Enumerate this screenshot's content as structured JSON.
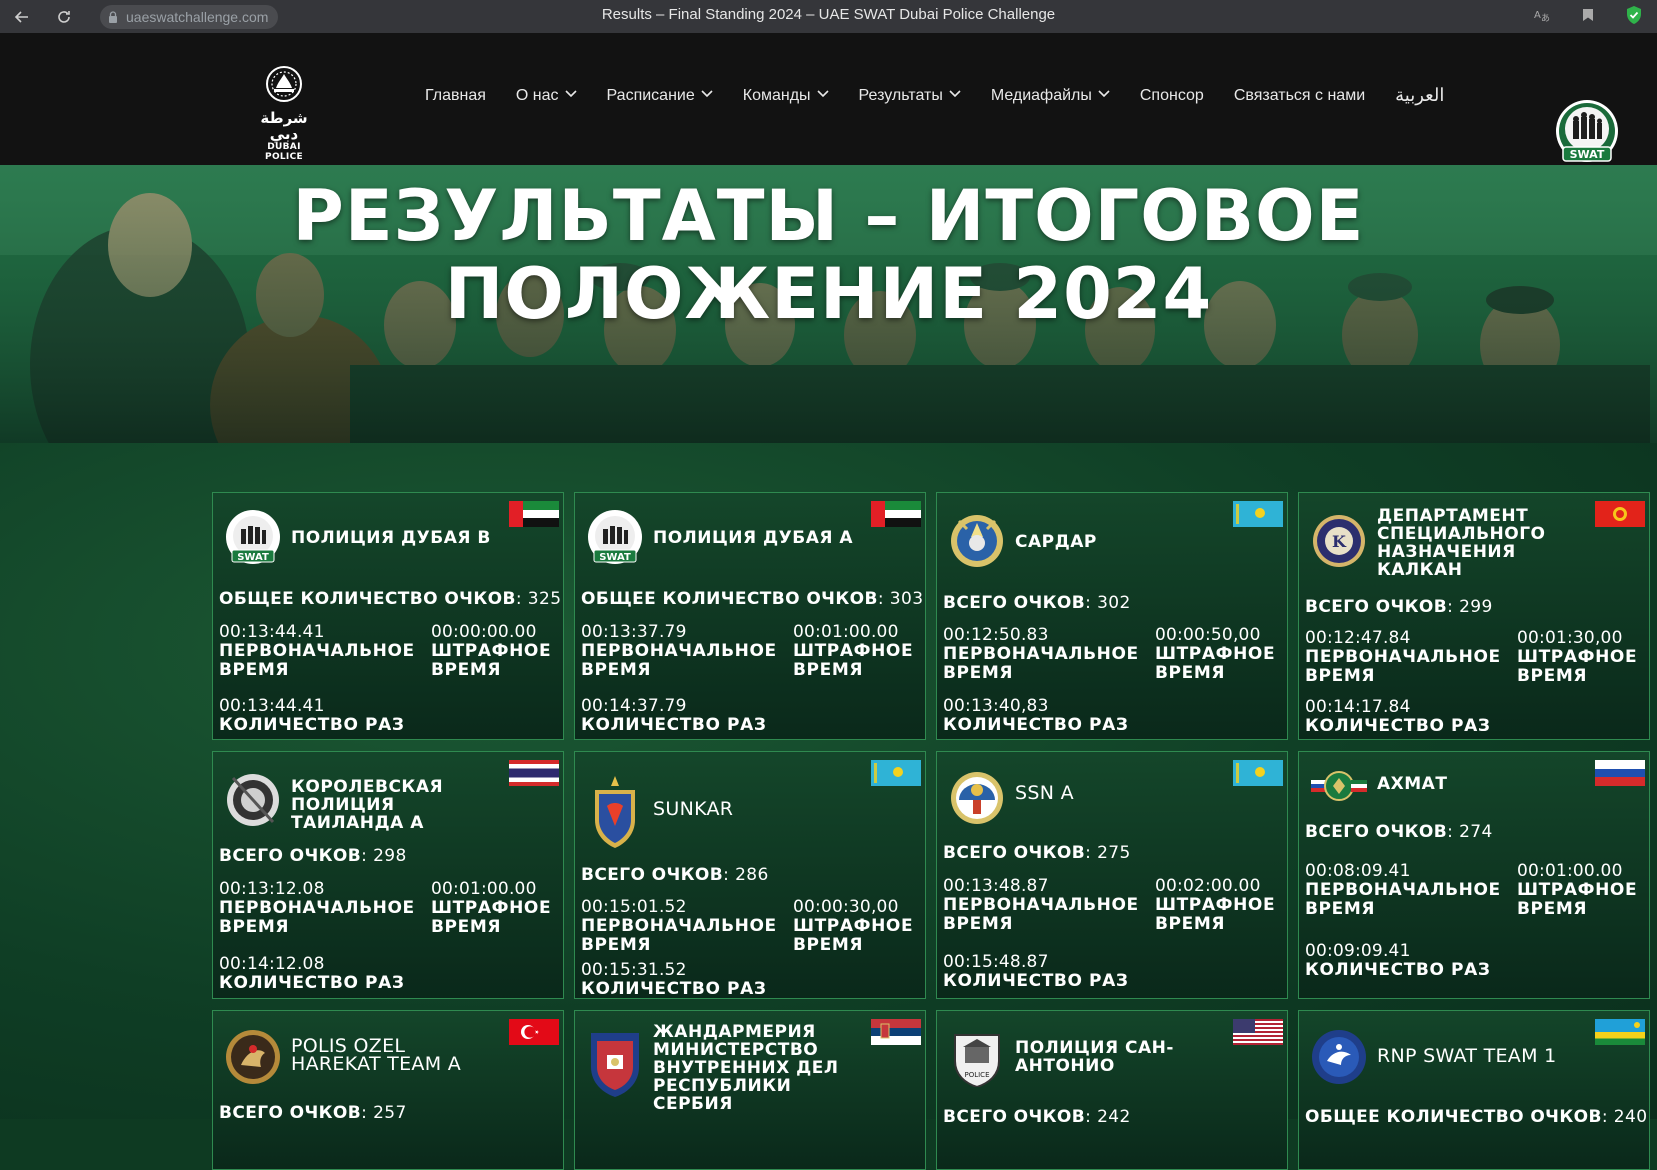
{
  "browser": {
    "url": "uaeswatchallenge.com",
    "title": "Results – Final Standing 2024 – UAE SWAT Dubai Police Challenge"
  },
  "header": {
    "logo_ar": "شرطة دبي",
    "logo_en": "DUBAI POLICE",
    "nav": [
      {
        "label": "Главная",
        "dropdown": false
      },
      {
        "label": "О нас",
        "dropdown": true
      },
      {
        "label": "Расписание",
        "dropdown": true
      },
      {
        "label": "Команды",
        "dropdown": true
      },
      {
        "label": "Результаты",
        "dropdown": true
      },
      {
        "label": "Медиафайлы",
        "dropdown": true
      },
      {
        "label": "Спонсор",
        "dropdown": false
      },
      {
        "label": "Связаться с нами",
        "dropdown": false
      },
      {
        "label": "العربية",
        "dropdown": false
      }
    ],
    "swat_label": "SWAT"
  },
  "hero": {
    "title_line1": "РЕЗУЛЬТАТЫ – ИТОГОВОЕ",
    "title_line2": "ПОЛОЖЕНИЕ 2024"
  },
  "labels": {
    "initial_time": "ПЕРВОНАЧАЛЬНОЕ ВРЕМЯ",
    "penalty_time": "ШТРАФНОЕ ВРЕМЯ",
    "count": "КОЛИЧЕСТВО РАЗ"
  },
  "teams": [
    {
      "name": "ПОЛИЦИЯ ДУБАЯ B",
      "flag": "uae",
      "logo": "swat-icon",
      "points_label": "ОБЩЕЕ КОЛИЧЕСТВО ОЧКОВ",
      "points": ": 325",
      "initial": "00:13:44.41",
      "penalty": "00:00:00.00",
      "total": "00:13:44.41"
    },
    {
      "name": "ПОЛИЦИЯ ДУБАЯ A",
      "flag": "uae",
      "logo": "swat-icon",
      "points_label": "ОБЩЕЕ КОЛИЧЕСТВО ОЧКОВ",
      "points": ": 303",
      "initial": "00:13:37.79",
      "penalty": "00:01:00.00",
      "total": "00:14:37.79"
    },
    {
      "name": "САРДАР",
      "flag": "kazakhstan",
      "logo": "sardar-emblem-icon",
      "points_label": "ВСЕГО ОЧКОВ",
      "points": ": 302",
      "initial": "00:12:50.83",
      "penalty": "00:00:50,00",
      "total": "00:13:40,83"
    },
    {
      "name": "ДЕПАРТАМЕНТ СПЕЦИАЛЬНОГО НАЗНАЧЕНИЯ КАЛКАН",
      "flag": "kyrgyzstan",
      "logo": "kalkan-emblem-icon",
      "points_label": "ВСЕГО ОЧКОВ",
      "points": ": 299",
      "initial": "00:12:47.84",
      "penalty": "00:01:30,00",
      "total": "00:14:17.84"
    },
    {
      "name": "КОРОЛЕВСКАЯ ПОЛИЦИЯ ТАИЛАНДА A",
      "flag": "thailand",
      "logo": "thai-police-emblem-icon",
      "points_label": "ВСЕГО ОЧКОВ",
      "points": ": 298",
      "initial": "00:13:12.08",
      "penalty": "00:01:00.00",
      "total": "00:14:12.08"
    },
    {
      "name": "SUNKAR",
      "flag": "kazakhstan",
      "logo": "sunkar-emblem-icon",
      "points_label": "ВСЕГО ОЧКОВ",
      "points": ": 286",
      "initial": "00:15:01.52",
      "penalty": "00:00:30,00",
      "total": "00:15:31.52"
    },
    {
      "name": "SSN A",
      "flag": "kazakhstan",
      "logo": "ssn-emblem-icon",
      "points_label": "ВСЕГО ОЧКОВ",
      "points": ": 275",
      "initial": "00:13:48.87",
      "penalty": "00:02:00.00",
      "total": "00:15:48.87"
    },
    {
      "name": "АХМАТ",
      "flag": "russia",
      "logo": "akhmat-emblem-icon",
      "points_label": "ВСЕГО ОЧКОВ",
      "points": ": 274",
      "initial": "00:08:09.41",
      "penalty": "00:01:00.00",
      "total": "00:09:09.41"
    },
    {
      "name": "POLIS OZEL HAREKAT TEAM A",
      "flag": "turkey",
      "logo": "turkiye-emblem-icon",
      "points_label": "ВСЕГО ОЧКОВ",
      "points": ": 257"
    },
    {
      "name": "ЖАНДАРМЕРИЯ МИНИСТЕРСТВО ВНУТРЕННИХ ДЕЛ РЕСПУБЛИКИ СЕРБИЯ",
      "flag": "serbia",
      "logo": "gendarmerie-emblem-icon",
      "points_label": "",
      "points": ""
    },
    {
      "name": "ПОЛИЦИЯ САН-АНТОНИО",
      "flag": "usa",
      "logo": "san-antonio-police-icon",
      "points_label": "ВСЕГО ОЧКОВ",
      "points": ": 242"
    },
    {
      "name": "RNP SWAT TEAM 1",
      "flag": "rwanda",
      "logo": "rnp-emblem-icon",
      "points_label": "ОБЩЕЕ КОЛИЧЕСТВО ОЧКОВ",
      "points": ": 240"
    }
  ]
}
